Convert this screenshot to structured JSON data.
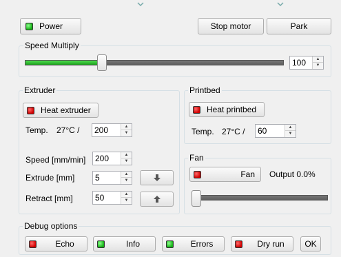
{
  "top": {
    "power_label": "Power",
    "stop_motor_label": "Stop motor",
    "park_label": "Park"
  },
  "speed_multiply": {
    "title": "Speed Multiply",
    "value": "100",
    "slider_level": 0.29
  },
  "extruder": {
    "title": "Extruder",
    "heat_button_label": "Heat extruder",
    "temp_label": "Temp.",
    "current_temp": "27°C /",
    "target_temp": "200",
    "speed_label": "Speed [mm/min]",
    "speed_value": "200",
    "extrude_label": "Extrude [mm]",
    "extrude_value": "5",
    "retract_label": "Retract [mm]",
    "retract_value": "50",
    "extrude_icon": "arrow-down-icon",
    "retract_icon": "arrow-up-icon"
  },
  "printbed": {
    "title": "Printbed",
    "heat_button_label": "Heat printbed",
    "temp_label": "Temp.",
    "current_temp": "27°C /",
    "target_temp": "60"
  },
  "fan": {
    "title": "Fan",
    "button_label": "Fan",
    "output_text": "Output 0.0%",
    "slider_level": 0.0
  },
  "debug": {
    "title": "Debug options",
    "echo_label": "Echo",
    "info_label": "Info",
    "errors_label": "Errors",
    "dry_run_label": "Dry run",
    "ok_label": "OK"
  },
  "colors": {
    "led_on": "#17b017",
    "led_off": "#d00000",
    "slider_fill": "#22b022"
  }
}
